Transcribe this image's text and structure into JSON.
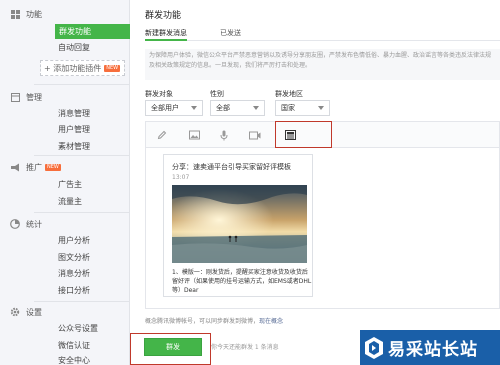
{
  "sidebar": {
    "groups": [
      {
        "icon": "grid-icon",
        "label": "功能",
        "items": [
          {
            "label": "群发功能",
            "active": true
          },
          {
            "label": "自动回复"
          }
        ],
        "add_plugin": "+ 添加功能插件",
        "add_badge": "NEW"
      },
      {
        "icon": "grid-icon",
        "label": "管理",
        "items": [
          {
            "label": "消息管理"
          },
          {
            "label": "用户管理"
          },
          {
            "label": "素材管理"
          }
        ]
      },
      {
        "icon": "megaphone-icon",
        "label": "推广",
        "badge": "NEW",
        "items": [
          {
            "label": "广告主"
          },
          {
            "label": "流量主"
          }
        ]
      },
      {
        "icon": "chart-icon",
        "label": "统计",
        "items": [
          {
            "label": "用户分析"
          },
          {
            "label": "图文分析"
          },
          {
            "label": "消息分析"
          },
          {
            "label": "接口分析"
          }
        ]
      },
      {
        "icon": "gear-icon",
        "label": "设置",
        "items": [
          {
            "label": "公众号设置"
          },
          {
            "label": "微信认证"
          },
          {
            "label": "安全中心"
          }
        ]
      }
    ]
  },
  "main": {
    "title": "群发功能",
    "tabs": [
      {
        "label": "新建群发消息",
        "active": true
      },
      {
        "label": "已发送"
      }
    ],
    "notice": "为保障用户体验，微信公众平台严禁恶意营销以及诱导分享朋友圈，严禁发布色情低俗、暴力血腥、政治谣言等各类违反法律法规及相关政策规定的信息。一旦发现，我们将严厉打击和处理。",
    "filters": [
      {
        "label": "群发对象",
        "value": "全部用户"
      },
      {
        "label": "性别",
        "value": "全部"
      },
      {
        "label": "群发地区",
        "value": "国家"
      }
    ],
    "toolbar": [
      {
        "icon": "pencil-icon"
      },
      {
        "icon": "image-icon"
      },
      {
        "icon": "microphone-icon"
      },
      {
        "icon": "video-icon"
      },
      {
        "icon": "news-icon",
        "selected": true
      }
    ],
    "message": {
      "title": "分享：速卖通平台引导买家留好评模板",
      "time": "13:07",
      "desc": "1、模版一：刚发货后，提醒买家注意收货及收货后留好评（如果使用的挂号运输方式，如EMS或者DHL等）Dear"
    },
    "status": {
      "text": "概念腾讯微博帐号，可以同步群发到微博，",
      "link": "现在概念"
    },
    "send_button": "群发",
    "quota": "你今天还能群发 1 条消息"
  },
  "logo": {
    "text": "易采站长站",
    "color": "#1a5fa8"
  }
}
